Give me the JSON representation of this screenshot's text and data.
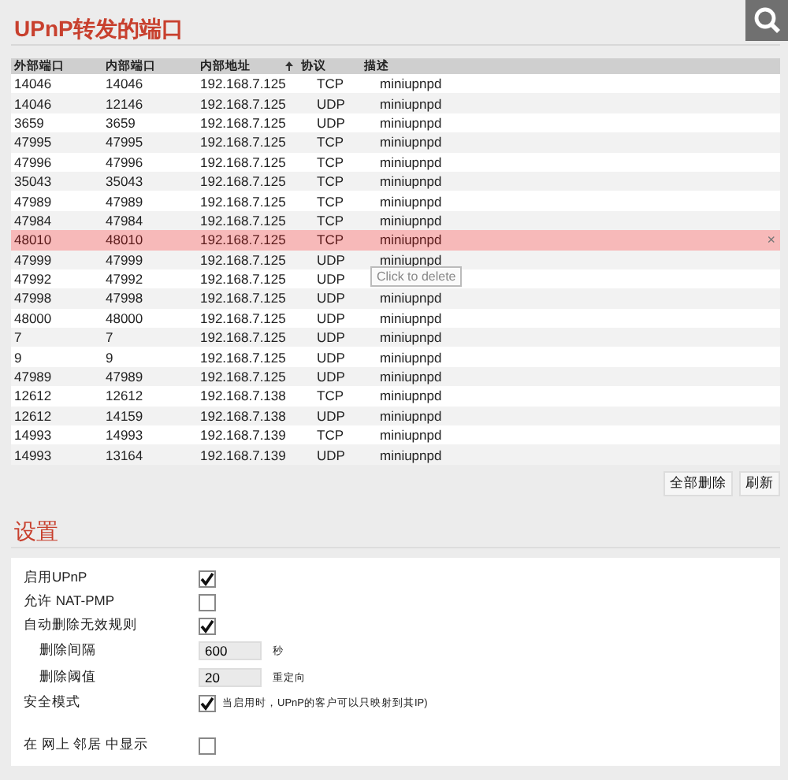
{
  "ports": {
    "title": "UPnP转发的端口",
    "columns": [
      "外部端口",
      "内部端口",
      "内部地址",
      "协议",
      "描述"
    ],
    "rows": [
      {
        "cells": [
          "14046",
          "14046",
          "192.168.7.125",
          "TCP",
          "miniupnpd"
        ],
        "highlighted": false
      },
      {
        "cells": [
          "14046",
          "12146",
          "192.168.7.125",
          "UDP",
          "miniupnpd"
        ],
        "highlighted": false
      },
      {
        "cells": [
          "3659",
          "3659",
          "192.168.7.125",
          "UDP",
          "miniupnpd"
        ],
        "highlighted": false
      },
      {
        "cells": [
          "47995",
          "47995",
          "192.168.7.125",
          "TCP",
          "miniupnpd"
        ],
        "highlighted": false
      },
      {
        "cells": [
          "47996",
          "47996",
          "192.168.7.125",
          "TCP",
          "miniupnpd"
        ],
        "highlighted": false
      },
      {
        "cells": [
          "35043",
          "35043",
          "192.168.7.125",
          "TCP",
          "miniupnpd"
        ],
        "highlighted": false
      },
      {
        "cells": [
          "47989",
          "47989",
          "192.168.7.125",
          "TCP",
          "miniupnpd"
        ],
        "highlighted": false
      },
      {
        "cells": [
          "47984",
          "47984",
          "192.168.7.125",
          "TCP",
          "miniupnpd"
        ],
        "highlighted": false
      },
      {
        "cells": [
          "48010",
          "48010",
          "192.168.7.125",
          "TCP",
          "miniupnpd"
        ],
        "highlighted": true,
        "delete": "×"
      },
      {
        "cells": [
          "47999",
          "47999",
          "192.168.7.125",
          "UDP",
          "miniupnpd"
        ],
        "highlighted": false
      },
      {
        "cells": [
          "47992",
          "47992",
          "192.168.7.125",
          "UDP"
        ],
        "highlighted": false
      },
      {
        "cells": [
          "47998",
          "47998",
          "192.168.7.125",
          "UDP",
          "miniupnpd"
        ],
        "highlighted": false
      },
      {
        "cells": [
          "48000",
          "48000",
          "192.168.7.125",
          "UDP",
          "miniupnpd"
        ],
        "highlighted": false
      },
      {
        "cells": [
          "7",
          "7",
          "192.168.7.125",
          "UDP",
          "miniupnpd"
        ],
        "highlighted": false
      },
      {
        "cells": [
          "9",
          "9",
          "192.168.7.125",
          "UDP",
          "miniupnpd"
        ],
        "highlighted": false
      },
      {
        "cells": [
          "47989",
          "47989",
          "192.168.7.125",
          "UDP",
          "miniupnpd"
        ],
        "highlighted": false
      },
      {
        "cells": [
          "12612",
          "12612",
          "192.168.7.138",
          "TCP",
          "miniupnpd"
        ],
        "highlighted": false
      },
      {
        "cells": [
          "12612",
          "14159",
          "192.168.7.138",
          "UDP",
          "miniupnpd"
        ],
        "highlighted": false
      },
      {
        "cells": [
          "14993",
          "14993",
          "192.168.7.139",
          "TCP",
          "miniupnpd"
        ],
        "highlighted": false
      },
      {
        "cells": [
          "14993",
          "13164",
          "192.168.7.139",
          "UDP",
          "miniupnpd"
        ],
        "highlighted": false
      }
    ],
    "tooltip": "Click to delete",
    "buttons": [
      "全部删除",
      "刷新"
    ]
  },
  "settings": {
    "title": "设置",
    "items": [
      {
        "kind": "checkbox",
        "label": "启用UPnP",
        "checked": true
      },
      {
        "kind": "checkbox",
        "label": "允许 NAT-PMP",
        "checked": false
      },
      {
        "kind": "checkbox",
        "label": "自动删除无效规则",
        "checked": true
      },
      {
        "kind": "number",
        "label": "删除间隔",
        "value": "600",
        "unit": "秒"
      },
      {
        "kind": "number",
        "label": "删除阈值",
        "value": "20",
        "unit": "重定向"
      },
      {
        "kind": "checkbox",
        "label": "安全模式",
        "checked": true,
        "note": "当启用时，UPnP的客户可以只映射到其IP)"
      },
      {
        "kind": "spacer"
      },
      {
        "kind": "checkbox",
        "label": "在 网上 邻居 中显示",
        "checked": false
      }
    ]
  }
}
